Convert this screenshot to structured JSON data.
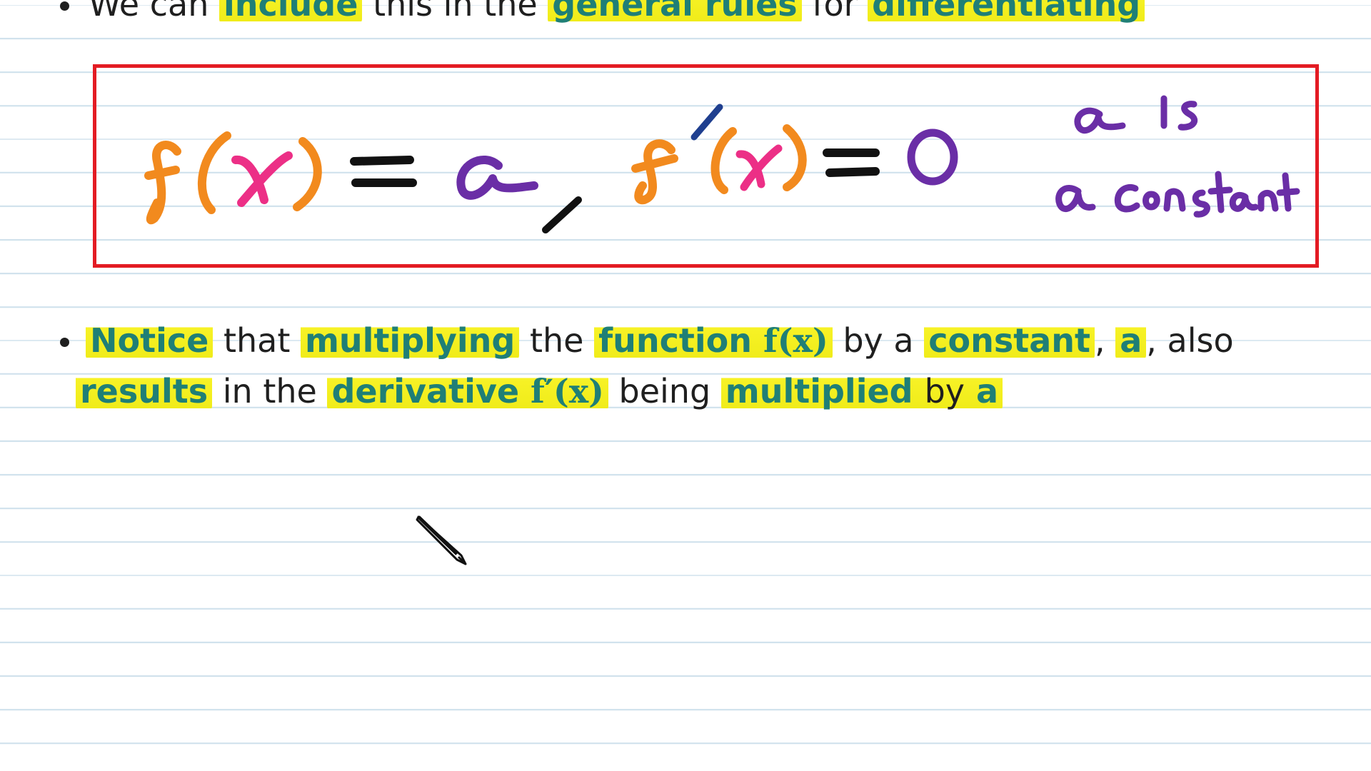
{
  "line1": {
    "w1": "We can",
    "w2": "include",
    "w3": "this in the",
    "w4": "general rules",
    "w5": "for",
    "w6": "differentiating"
  },
  "handwritten": {
    "fx": "f(x) = a",
    "fpx": "f′(x) = 0",
    "note_line1": "a is",
    "note_line2": "a constant"
  },
  "line2": {
    "w1": "Notice",
    "w2": "that",
    "w3": "multiplying",
    "w4": "the",
    "w5": "function",
    "w6": "f(x)",
    "w7": "by a",
    "w8": "constant",
    "w9": ",",
    "w10": "a",
    "w11": ", also"
  },
  "line3": {
    "w1": "results",
    "w2": "in the",
    "w3": "derivative",
    "w4": "f′(x)",
    "w5": "being",
    "w6": "multiplied",
    "w7": "by",
    "w8": "a"
  },
  "colors": {
    "keyword": "#1f7f76",
    "highlight": "#f2ee1d",
    "box_border": "#e31b23",
    "ink_orange": "#f28a1e",
    "ink_pink": "#ec2f86",
    "ink_purple": "#6a2ea6",
    "ink_black": "#111111",
    "ink_blue": "#1f3f8f"
  }
}
